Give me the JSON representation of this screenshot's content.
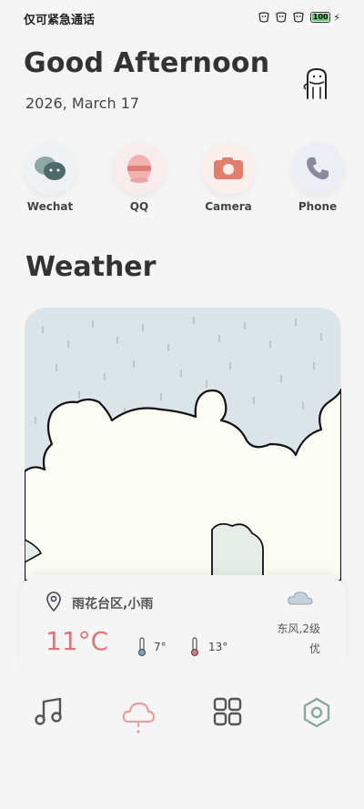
{
  "status_bar": {
    "carrier_text": "仅可紧急通话",
    "battery_level": "100",
    "charging_icon": "bolt-icon",
    "battery_color": "#67c26e"
  },
  "header": {
    "greeting": "Good Afternoon",
    "date": "2026, March  17",
    "mascot_icon": "mascot-icon"
  },
  "apps": [
    {
      "label": "Wechat",
      "icon": "wechat-icon",
      "bg": "#eef2f2"
    },
    {
      "label": "QQ",
      "icon": "qq-icon",
      "bg": "#f9ecec"
    },
    {
      "label": "Camera",
      "icon": "camera-icon",
      "bg": "#fbefec"
    },
    {
      "label": "Phone",
      "icon": "phone-icon",
      "bg": "#ededf5"
    }
  ],
  "weather_section": {
    "title": "Weather"
  },
  "weather": {
    "location": "雨花台区,小雨",
    "temperature": "11°C",
    "low": "7°",
    "high": "13°",
    "wind": "东风,2级",
    "air_quality": "优",
    "condition_icon": "cloud-icon",
    "temp_color": "#d9787a"
  },
  "bottom_nav": [
    {
      "icon": "music-icon"
    },
    {
      "icon": "weather-cloud-icon",
      "active": true
    },
    {
      "icon": "apps-grid-icon"
    },
    {
      "icon": "settings-icon"
    }
  ]
}
